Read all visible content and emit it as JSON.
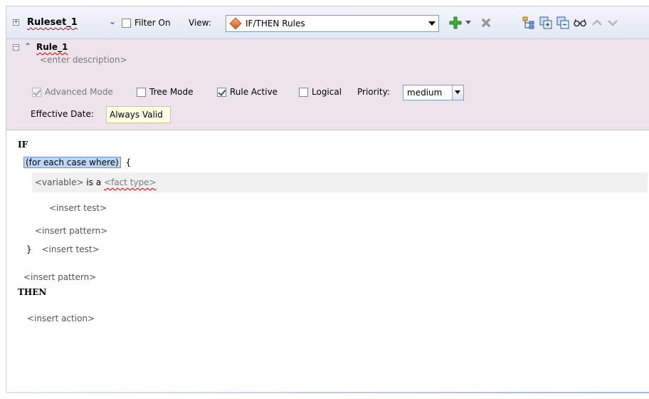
{
  "ruleset": {
    "name": "Ruleset_1",
    "filter_label": "Filter On",
    "view_label": "View:",
    "view_value": "IF/THEN Rules"
  },
  "rule": {
    "name": "Rule_1",
    "description_placeholder": "<enter description>",
    "options": {
      "advanced_mode": "Advanced Mode",
      "tree_mode": "Tree Mode",
      "rule_active": "Rule Active",
      "logical": "Logical"
    },
    "priority_label": "Priority:",
    "priority_value": "medium",
    "effective_date_label": "Effective Date:",
    "effective_date_value": "Always Valid"
  },
  "body": {
    "if_keyword": "IF",
    "for_each": "(for each case where)",
    "open_brace": "{",
    "variable": "<variable>",
    "is_a": "is a",
    "fact_type": "<fact type>",
    "insert_test_inner": "<insert test>",
    "insert_pattern_inner": "<insert pattern>",
    "close_brace": "}",
    "insert_test_outer": "<insert test>",
    "insert_pattern_outer": "<insert pattern>",
    "then_keyword": "THEN",
    "insert_action": "<insert action>"
  },
  "colors": {
    "toolbar_bg": "#e6ebf5",
    "rule_header_bg": "#ece4ea",
    "selection": "#bcd7f5",
    "error_underline": "#d00000",
    "add_icon": "#2d9e2d",
    "delete_icon": "#8c8c8c"
  },
  "icons": [
    "expand-icon",
    "collapse-up-icon",
    "dropdown-arrow-icon",
    "add-icon",
    "delete-icon",
    "tree-icon",
    "expand-all-icon",
    "collapse-all-icon",
    "glasses-icon",
    "move-up-icon",
    "move-down-icon"
  ]
}
